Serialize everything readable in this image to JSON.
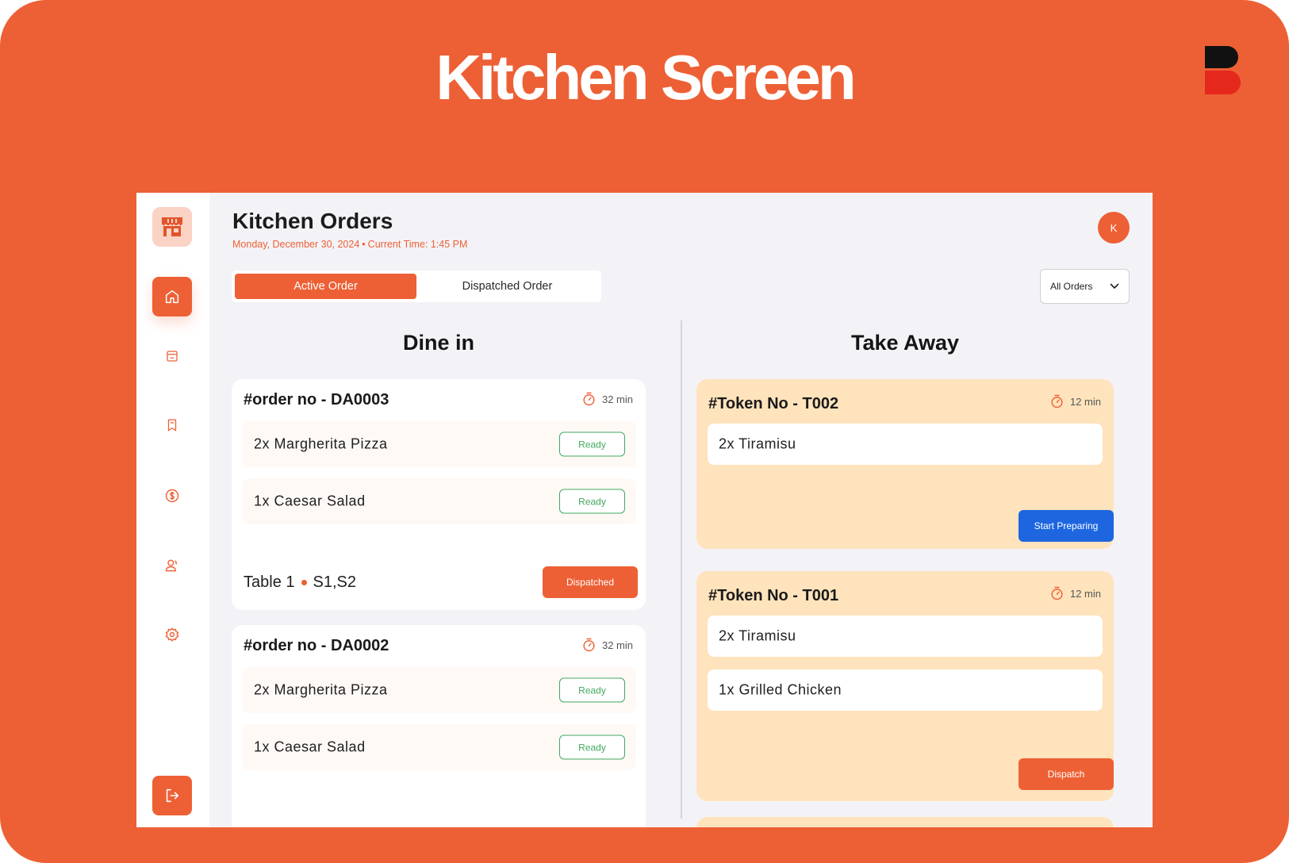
{
  "hero": {
    "title": "Kitchen Screen"
  },
  "colors": {
    "accent": "#ED6035",
    "ready": "#41A85F",
    "blue": "#1D66E0",
    "takeaway_card": "#FFE3BC"
  },
  "sidebar": {
    "logo_icon": "store-icon",
    "items": [
      {
        "icon": "home-icon",
        "active": true
      },
      {
        "icon": "calendar-icon",
        "active": false
      },
      {
        "icon": "bookmark-icon",
        "active": false
      },
      {
        "icon": "dollar-icon",
        "active": false
      },
      {
        "icon": "users-icon",
        "active": false
      },
      {
        "icon": "gear-icon",
        "active": false
      }
    ],
    "logout_icon": "logout-icon"
  },
  "header": {
    "title": "Kitchen Orders",
    "date": "Monday, December 30, 2024",
    "separator": "•",
    "time": "Current Time: 1:45 PM",
    "avatar_initial": "K"
  },
  "tabs": [
    {
      "label": "Active Order",
      "active": true
    },
    {
      "label": "Dispatched Order",
      "active": false
    }
  ],
  "filter": {
    "selected": "All Orders"
  },
  "dine_in": {
    "heading": "Dine in",
    "orders": [
      {
        "title": "#order no - DA0003",
        "timer": "32 min",
        "items": [
          {
            "name": "2x Margherita Pizza",
            "status": "Ready"
          },
          {
            "name": "1x Caesar Salad",
            "status": "Ready"
          }
        ],
        "table": "Table 1",
        "seats": "S1,S2",
        "action": "Dispatched"
      },
      {
        "title": "#order no - DA0002",
        "timer": "32 min",
        "items": [
          {
            "name": "2x Margherita Pizza",
            "status": "Ready"
          },
          {
            "name": "1x Caesar Salad",
            "status": "Ready"
          }
        ]
      }
    ]
  },
  "take_away": {
    "heading": "Take Away",
    "orders": [
      {
        "title": "#Token No - T002",
        "timer": "12 min",
        "items": [
          {
            "name": "2x Tiramisu"
          }
        ],
        "action": "Start Preparing"
      },
      {
        "title": "#Token No - T001",
        "timer": "12 min",
        "items": [
          {
            "name": "2x Tiramisu"
          },
          {
            "name": "1x Grilled Chicken"
          }
        ],
        "action": "Dispatch"
      }
    ]
  }
}
